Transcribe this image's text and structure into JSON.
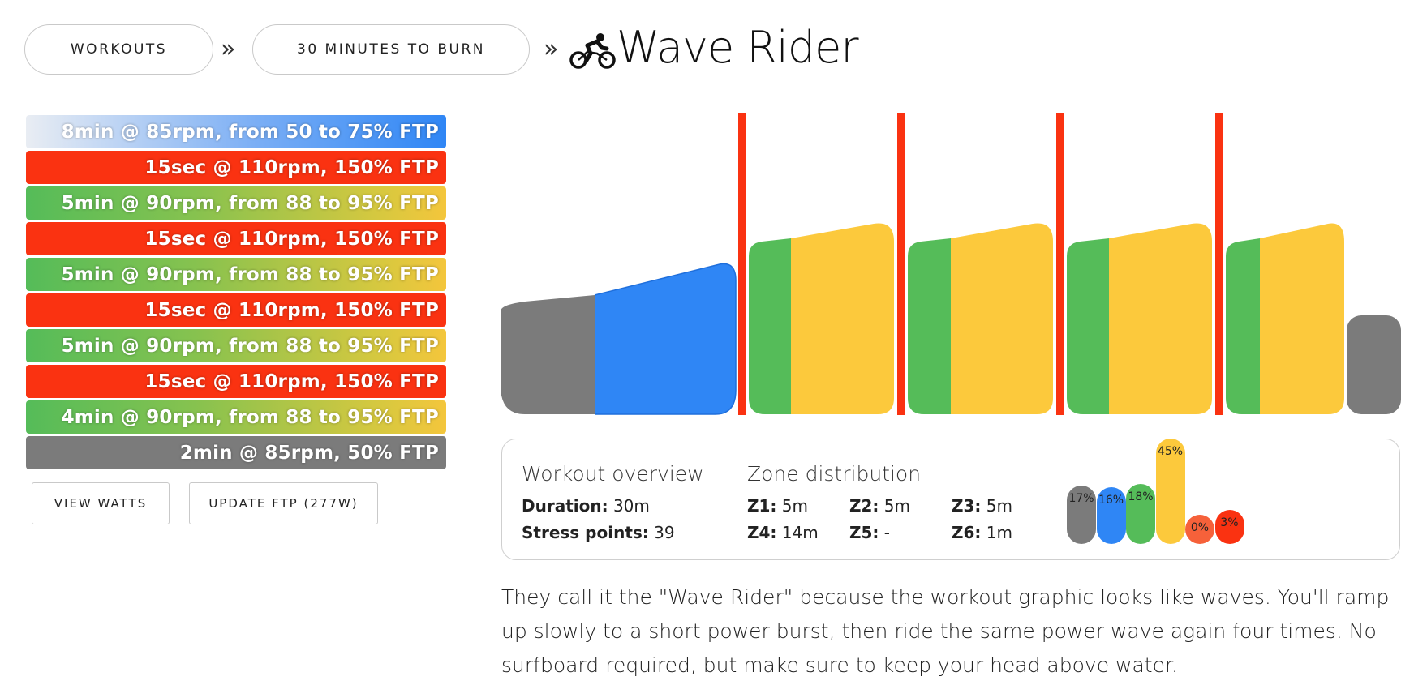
{
  "breadcrumb": {
    "items": [
      "WORKOUTS",
      "30 MINUTES TO BURN"
    ],
    "separator": "»",
    "title": "Wave Rider",
    "title_icon": "cyclist-icon"
  },
  "steps": [
    {
      "label": "8min @ 85rpm, from 50 to 75% FTP",
      "zone": "warmup"
    },
    {
      "label": "15sec @ 110rpm, 150% FTP",
      "zone": "red"
    },
    {
      "label": "5min @ 90rpm, from 88 to 95% FTP",
      "zone": "green"
    },
    {
      "label": "15sec @ 110rpm, 150% FTP",
      "zone": "red"
    },
    {
      "label": "5min @ 90rpm, from 88 to 95% FTP",
      "zone": "green"
    },
    {
      "label": "15sec @ 110rpm, 150% FTP",
      "zone": "red"
    },
    {
      "label": "5min @ 90rpm, from 88 to 95% FTP",
      "zone": "green"
    },
    {
      "label": "15sec @ 110rpm, 150% FTP",
      "zone": "red"
    },
    {
      "label": "4min @ 90rpm, from 88 to 95% FTP",
      "zone": "green"
    },
    {
      "label": "2min @ 85rpm, 50% FTP",
      "zone": "gray"
    }
  ],
  "buttons": {
    "view_watts": "VIEW WATTS",
    "update_ftp": "UPDATE FTP (277W)"
  },
  "overview": {
    "heading": "Workout overview",
    "duration_label": "Duration:",
    "duration_value": "30m",
    "stress_label": "Stress points:",
    "stress_value": "39"
  },
  "zones": {
    "heading": "Zone distribution",
    "items": [
      {
        "label": "Z1:",
        "value": "5m"
      },
      {
        "label": "Z2:",
        "value": "5m"
      },
      {
        "label": "Z3:",
        "value": "5m"
      },
      {
        "label": "Z4:",
        "value": "14m"
      },
      {
        "label": "Z5:",
        "value": "-"
      },
      {
        "label": "Z6:",
        "value": "1m"
      }
    ],
    "distribution": [
      {
        "pct": "17%",
        "value": 17,
        "color": "#7b7b7b"
      },
      {
        "pct": "16%",
        "value": 16,
        "color": "#2f86f5"
      },
      {
        "pct": "18%",
        "value": 18,
        "color": "#55bc59"
      },
      {
        "pct": "45%",
        "value": 45,
        "color": "#fcc93c"
      },
      {
        "pct": "0%",
        "value": 0,
        "color": "#f6613a"
      },
      {
        "pct": "3%",
        "value": 3,
        "color": "#fa3211"
      }
    ]
  },
  "description": "They call it the \"Wave Rider\" because the workout graphic looks like waves. You'll ramp up slowly to a short power burst, then ride the same power wave again four times. No surfboard required, but make sure to keep your head above water.",
  "colors": {
    "zone1": "#7b7b7b",
    "zone2": "#2f86f5",
    "zone3": "#55bc59",
    "zone4": "#fcc93c",
    "zone5": "#f6613a",
    "zone6": "#fa3211"
  }
}
